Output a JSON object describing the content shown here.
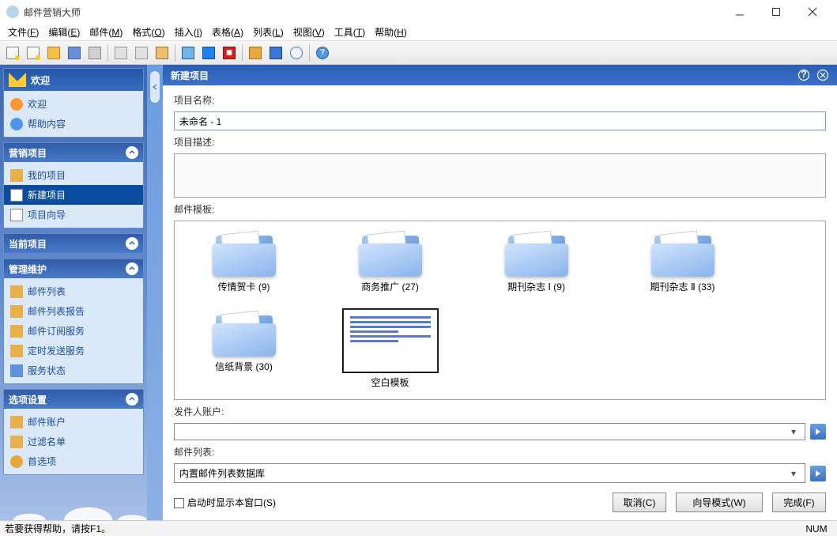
{
  "window": {
    "title": "邮件营销大师"
  },
  "menu": [
    {
      "label": "文件",
      "key": "F"
    },
    {
      "label": "编辑",
      "key": "E"
    },
    {
      "label": "邮件",
      "key": "M"
    },
    {
      "label": "格式",
      "key": "O"
    },
    {
      "label": "插入",
      "key": "I"
    },
    {
      "label": "表格",
      "key": "A"
    },
    {
      "label": "列表",
      "key": "L"
    },
    {
      "label": "视图",
      "key": "V"
    },
    {
      "label": "工具",
      "key": "T"
    },
    {
      "label": "帮助",
      "key": "H"
    }
  ],
  "sidebar": {
    "welcome": {
      "header": "欢迎",
      "items": [
        {
          "label": "欢迎",
          "icon": "pi-home"
        },
        {
          "label": "帮助内容",
          "icon": "pi-help"
        }
      ]
    },
    "project": {
      "header": "营销项目",
      "items": [
        {
          "label": "我的项目",
          "icon": "pi-folder"
        },
        {
          "label": "新建项目",
          "icon": "pi-new",
          "selected": true
        },
        {
          "label": "项目向导",
          "icon": "pi-wizard"
        }
      ]
    },
    "current": {
      "header": "当前项目"
    },
    "manage": {
      "header": "管理维护",
      "items": [
        {
          "label": "邮件列表",
          "icon": "pi-list"
        },
        {
          "label": "邮件列表报告",
          "icon": "pi-report"
        },
        {
          "label": "邮件订阅服务",
          "icon": "pi-sub"
        },
        {
          "label": "定时发送服务",
          "icon": "pi-timer"
        },
        {
          "label": "服务状态",
          "icon": "pi-status"
        }
      ]
    },
    "options": {
      "header": "选项设置",
      "items": [
        {
          "label": "邮件账户",
          "icon": "pi-account"
        },
        {
          "label": "过滤名单",
          "icon": "pi-filter"
        },
        {
          "label": "首选项",
          "icon": "pi-pref"
        }
      ]
    }
  },
  "content": {
    "header": "新建项目",
    "labels": {
      "name": "项目名称:",
      "desc": "项目描述:",
      "template": "邮件模板:",
      "sender": "发件人账户:",
      "maillist": "邮件列表:"
    },
    "name_value": "未命名 - 1",
    "desc_value": "",
    "templates": [
      {
        "label": "传情贺卡 (9)",
        "type": "folder"
      },
      {
        "label": "商务推广 (27)",
        "type": "folder"
      },
      {
        "label": "期刊杂志 Ⅰ (9)",
        "type": "folder"
      },
      {
        "label": "期刊杂志 Ⅱ (33)",
        "type": "folder"
      },
      {
        "label": "信纸背景 (30)",
        "type": "folder"
      },
      {
        "label": "空白模板",
        "type": "blank",
        "selected": true
      }
    ],
    "sender_value": "",
    "maillist_value": "内置邮件列表数据库",
    "checkbox_label": "启动时显示本窗口(S)",
    "buttons": {
      "cancel": "取消(C)",
      "wizard": "向导模式(W)",
      "finish": "完成(F)"
    }
  },
  "statusbar": {
    "text": "若要获得帮助，请按F1。",
    "num": "NUM"
  }
}
